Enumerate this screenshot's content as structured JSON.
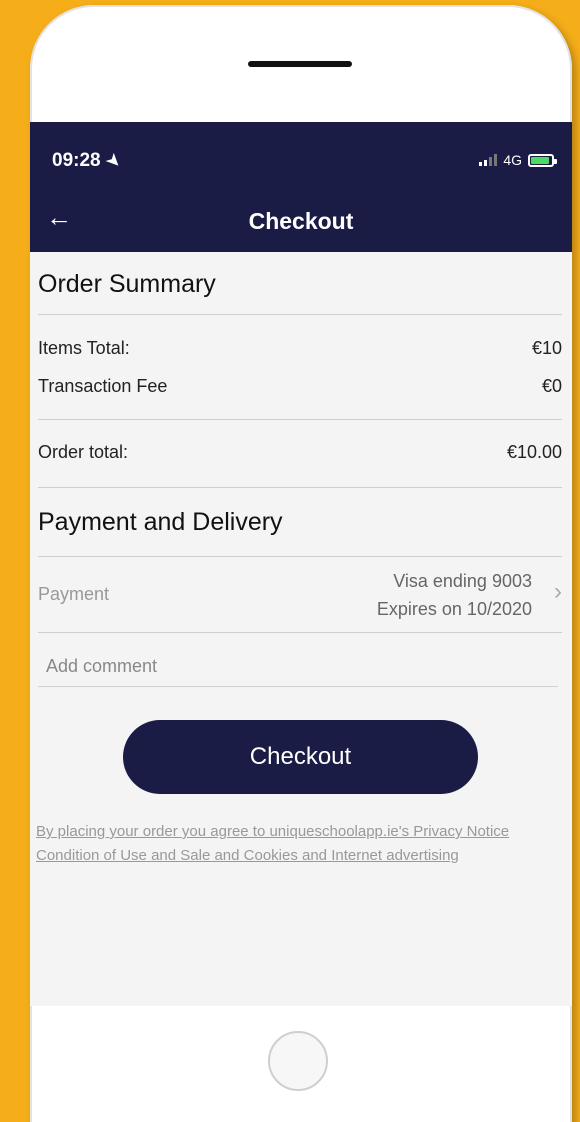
{
  "status_bar": {
    "time": "09:28",
    "network": "4G"
  },
  "header": {
    "title": "Checkout",
    "back_icon": "←"
  },
  "order_summary": {
    "title": "Order Summary",
    "items": [
      {
        "label": "Items Total:",
        "value": "€10"
      },
      {
        "label": "Transaction Fee",
        "value": "€0"
      }
    ],
    "total_label": "Order total:",
    "total_value": "€10.00"
  },
  "payment_delivery": {
    "title": "Payment and Delivery",
    "payment_label": "Payment",
    "payment_line1": "Visa ending 9003",
    "payment_line2": "Expires on 10/2020",
    "comment_placeholder": "Add comment"
  },
  "actions": {
    "checkout_label": "Checkout"
  },
  "legal_text": "By placing your order you agree to uniqueschoolapp.ie's Privacy Notice Condition of Use and Sale and Cookies and Internet advertising",
  "colors": {
    "primary": "#1b1c45",
    "frame": "#f5ae19",
    "battery": "#4cd964"
  }
}
